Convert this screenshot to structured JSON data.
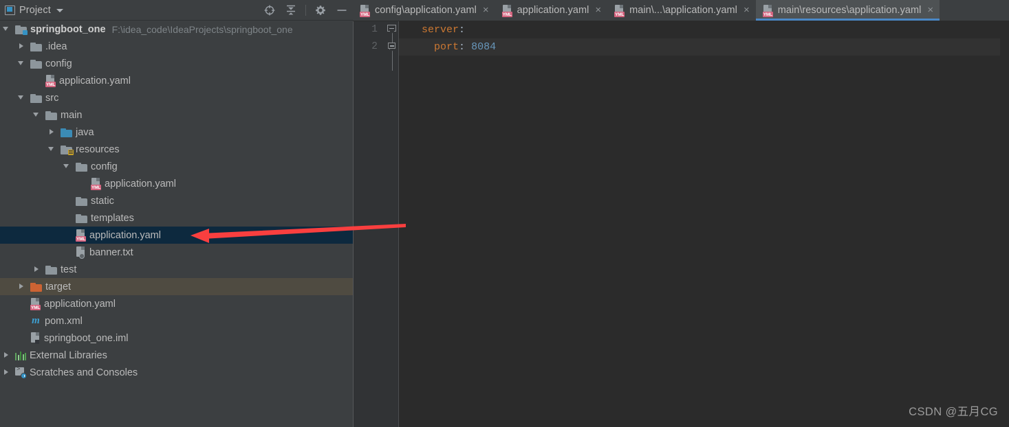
{
  "panel": {
    "title": "Project",
    "window_icon": "project-window-icon",
    "dropdown_icon": "chevron-down-icon",
    "tools": [
      {
        "name": "scroll-from-source-icon",
        "title": "Select Opened File"
      },
      {
        "name": "collapse-all-icon",
        "title": "Collapse All"
      },
      {
        "name": "gear-icon",
        "title": "Settings"
      },
      {
        "name": "minimize-icon",
        "title": "Hide"
      }
    ]
  },
  "tree": [
    {
      "label": "springboot_one",
      "path": "F:\\idea_code\\IdeaProjects\\springboot_one",
      "indent": 0,
      "twisty": "expanded",
      "icon": "project-module-folder-icon",
      "bold": true,
      "state": "normal"
    },
    {
      "label": ".idea",
      "path": "",
      "indent": 1,
      "twisty": "collapsed",
      "icon": "folder-icon",
      "bold": false,
      "state": "normal"
    },
    {
      "label": "config",
      "path": "",
      "indent": 1,
      "twisty": "expanded",
      "icon": "folder-icon",
      "bold": false,
      "state": "normal"
    },
    {
      "label": "application.yaml",
      "path": "",
      "indent": 2,
      "twisty": "none",
      "icon": "yaml-file-icon",
      "bold": false,
      "state": "normal"
    },
    {
      "label": "src",
      "path": "",
      "indent": 1,
      "twisty": "expanded",
      "icon": "folder-icon",
      "bold": false,
      "state": "normal"
    },
    {
      "label": "main",
      "path": "",
      "indent": 2,
      "twisty": "expanded",
      "icon": "folder-icon",
      "bold": false,
      "state": "normal"
    },
    {
      "label": "java",
      "path": "",
      "indent": 3,
      "twisty": "collapsed",
      "icon": "sources-root-folder-icon",
      "bold": false,
      "state": "normal"
    },
    {
      "label": "resources",
      "path": "",
      "indent": 3,
      "twisty": "expanded",
      "icon": "resources-root-folder-icon",
      "bold": false,
      "state": "normal"
    },
    {
      "label": "config",
      "path": "",
      "indent": 4,
      "twisty": "expanded",
      "icon": "folder-icon",
      "bold": false,
      "state": "normal"
    },
    {
      "label": "application.yaml",
      "path": "",
      "indent": 5,
      "twisty": "none",
      "icon": "yaml-file-icon",
      "bold": false,
      "state": "normal"
    },
    {
      "label": "static",
      "path": "",
      "indent": 4,
      "twisty": "none",
      "icon": "folder-icon",
      "bold": false,
      "state": "normal"
    },
    {
      "label": "templates",
      "path": "",
      "indent": 4,
      "twisty": "none",
      "icon": "folder-icon",
      "bold": false,
      "state": "normal"
    },
    {
      "label": "application.yaml",
      "path": "",
      "indent": 4,
      "twisty": "none",
      "icon": "yaml-file-icon",
      "bold": false,
      "state": "selected"
    },
    {
      "label": "banner.txt",
      "path": "",
      "indent": 4,
      "twisty": "none",
      "icon": "text-file-icon",
      "bold": false,
      "state": "normal"
    },
    {
      "label": "test",
      "path": "",
      "indent": 2,
      "twisty": "collapsed",
      "icon": "folder-icon",
      "bold": false,
      "state": "normal"
    },
    {
      "label": "target",
      "path": "",
      "indent": 1,
      "twisty": "collapsed",
      "icon": "excluded-folder-icon",
      "bold": false,
      "state": "excluded"
    },
    {
      "label": "application.yaml",
      "path": "",
      "indent": 1,
      "twisty": "none",
      "icon": "yaml-file-icon",
      "bold": false,
      "state": "normal"
    },
    {
      "label": "pom.xml",
      "path": "",
      "indent": 1,
      "twisty": "none",
      "icon": "maven-file-icon",
      "bold": false,
      "state": "normal"
    },
    {
      "label": "springboot_one.iml",
      "path": "",
      "indent": 1,
      "twisty": "none",
      "icon": "iml-file-icon",
      "bold": false,
      "state": "normal"
    },
    {
      "label": "External Libraries",
      "path": "",
      "indent": 0,
      "twisty": "collapsed",
      "icon": "libraries-icon",
      "bold": false,
      "state": "normal"
    },
    {
      "label": "Scratches and Consoles",
      "path": "",
      "indent": 0,
      "twisty": "collapsed",
      "icon": "scratches-console-icon",
      "bold": false,
      "state": "normal"
    }
  ],
  "tabs": [
    {
      "label": "config\\application.yaml",
      "icon": "yaml-file-icon",
      "close_icon": "close-icon",
      "active": false
    },
    {
      "label": "application.yaml",
      "icon": "yaml-file-icon",
      "close_icon": "close-icon",
      "active": false
    },
    {
      "label": "main\\...\\application.yaml",
      "icon": "yaml-file-icon",
      "close_icon": "close-icon",
      "active": false
    },
    {
      "label": "main\\resources\\application.yaml",
      "icon": "yaml-file-icon",
      "close_icon": "close-icon",
      "active": true
    }
  ],
  "editor": {
    "line_numbers": [
      "1",
      "2"
    ],
    "lines": [
      {
        "key": "server",
        "colon": ":",
        "value": "",
        "indent": ""
      },
      {
        "key": "port",
        "colon": ":",
        "value": "8084",
        "indent": "  "
      }
    ],
    "fold_markers": [
      "fold-collapse-icon",
      "fold-collapse-icon"
    ]
  },
  "annotation": {
    "arrow_icon": "red-pointer-arrow",
    "color": "#f93f3f"
  },
  "watermark": "CSDN @五月CG",
  "colors": {
    "sidebar_bg": "#3c3f41",
    "editor_bg": "#2b2b2b",
    "gutter_bg": "#313335",
    "selection_bg": "#0d293e",
    "excluded_bg": "#4f4b41",
    "active_tab_underline": "#4a88c7",
    "yaml_key": "#cc7832",
    "yaml_number": "#6897bb"
  }
}
